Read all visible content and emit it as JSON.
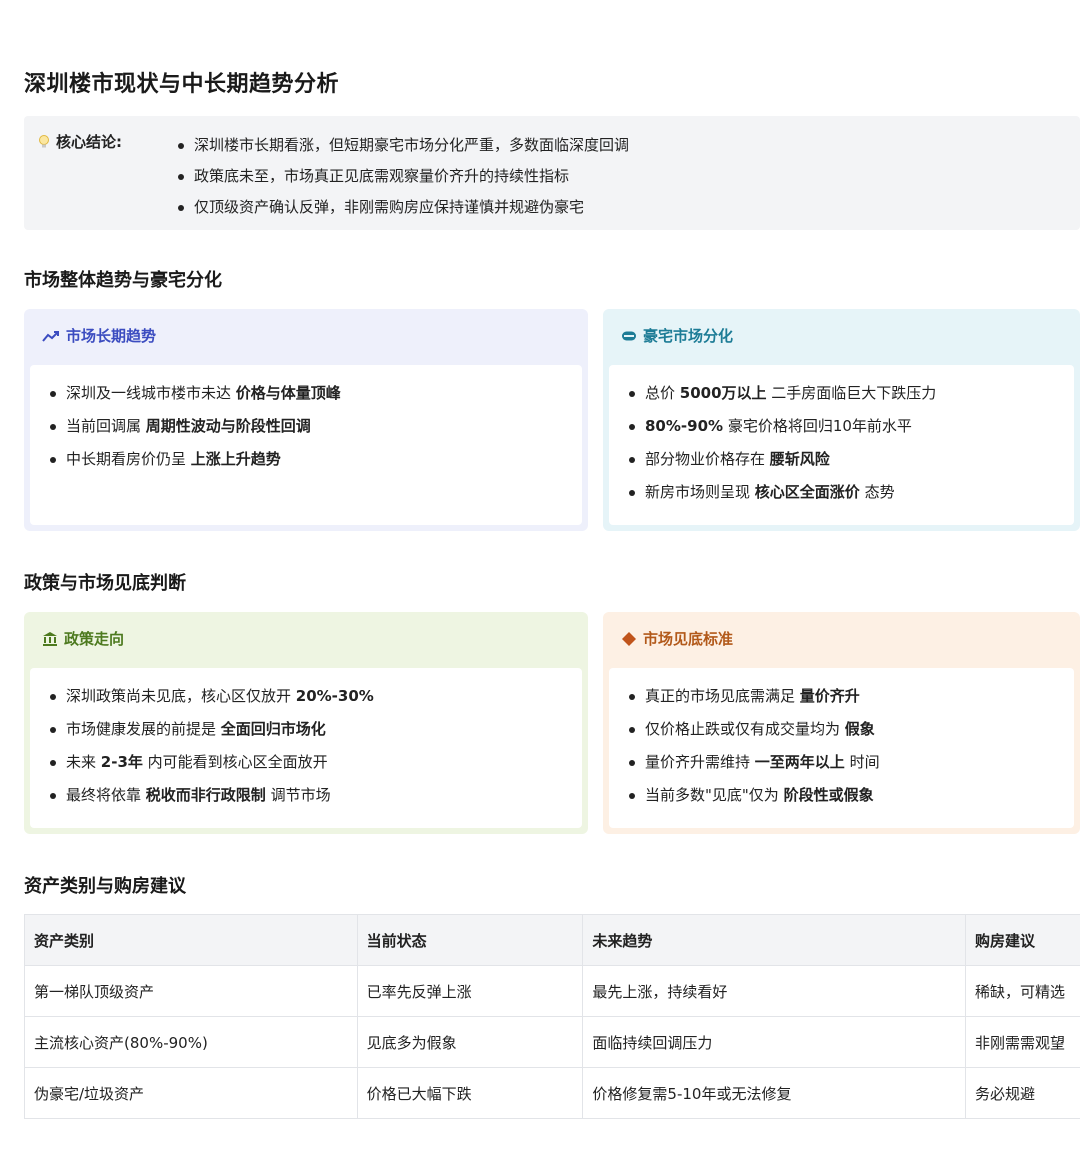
{
  "title": "深圳楼市现状与中长期趋势分析",
  "conclusion": {
    "label": "核心结论:",
    "items": [
      "深圳楼市长期看涨，但短期豪宅市场分化严重，多数面临深度回调",
      "政策底未至，市场真正见底需观察量价齐升的持续性指标",
      "仅顶级资产确认反弹，非刚需购房应保持谨慎并规避伪豪宅"
    ]
  },
  "section1": {
    "title": "市场整体趋势与豪宅分化",
    "card_left": {
      "title": "市场长期趋势",
      "items": [
        {
          "pre": "深圳及一线城市楼市未达 ",
          "bold": "价格与体量顶峰",
          "post": ""
        },
        {
          "pre": "当前回调属 ",
          "bold": "周期性波动与阶段性回调",
          "post": ""
        },
        {
          "pre": "中长期看房价仍呈 ",
          "bold": "上涨上升趋势",
          "post": ""
        }
      ]
    },
    "card_right": {
      "title": "豪宅市场分化",
      "items": [
        {
          "pre": "总价 ",
          "bold": "5000万以上",
          "post": " 二手房面临巨大下跌压力"
        },
        {
          "pre": "",
          "bold": "80%-90%",
          "post": " 豪宅价格将回归10年前水平"
        },
        {
          "pre": "部分物业价格存在 ",
          "bold": "腰斩风险",
          "post": ""
        },
        {
          "pre": "新房市场则呈现 ",
          "bold": "核心区全面涨价",
          "post": " 态势"
        }
      ]
    }
  },
  "section2": {
    "title": "政策与市场见底判断",
    "card_left": {
      "title": "政策走向",
      "items": [
        {
          "pre": "深圳政策尚未见底，核心区仅放开 ",
          "bold": "20%-30%",
          "post": ""
        },
        {
          "pre": "市场健康发展的前提是 ",
          "bold": "全面回归市场化",
          "post": ""
        },
        {
          "pre": "未来 ",
          "bold": "2-3年",
          "post": " 内可能看到核心区全面放开"
        },
        {
          "pre": "最终将依靠 ",
          "bold": "税收而非行政限制",
          "post": " 调节市场"
        }
      ]
    },
    "card_right": {
      "title": "市场见底标准",
      "items": [
        {
          "pre": "真正的市场见底需满足 ",
          "bold": "量价齐升",
          "post": ""
        },
        {
          "pre": "仅价格止跌或仅有成交量均为 ",
          "bold": "假象",
          "post": ""
        },
        {
          "pre": "量价齐升需维持 ",
          "bold": "一至两年以上",
          "post": " 时间"
        },
        {
          "pre": "当前多数\"见底\"仅为 ",
          "bold": "阶段性或假象",
          "post": ""
        }
      ]
    }
  },
  "section3": {
    "title": "资产类别与购房建议",
    "headers": [
      "资产类别",
      "当前状态",
      "未来趋势",
      "购房建议"
    ],
    "rows": [
      [
        "第一梯队顶级资产",
        "已率先反弹上涨",
        "最先上涨，持续看好",
        "稀缺，可精选"
      ],
      [
        "主流核心资产(80%-90%)",
        "见底多为假象",
        "面临持续回调压力",
        "非刚需需观望"
      ],
      [
        "伪豪宅/垃圾资产",
        "价格已大幅下跌",
        "价格修复需5-10年或无法修复",
        "务必规避"
      ]
    ]
  },
  "icons": {
    "conclusion": "lightbulb-icon",
    "trend": "trending-up-icon",
    "luxury": "capsule-icon",
    "policy": "bank-icon",
    "bottom": "diamond-icon"
  },
  "colors": {
    "blue_accent": "#3b4cc0",
    "teal_accent": "#1d7c96",
    "green_accent": "#4d7a1f",
    "orange_accent": "#b2591a"
  }
}
